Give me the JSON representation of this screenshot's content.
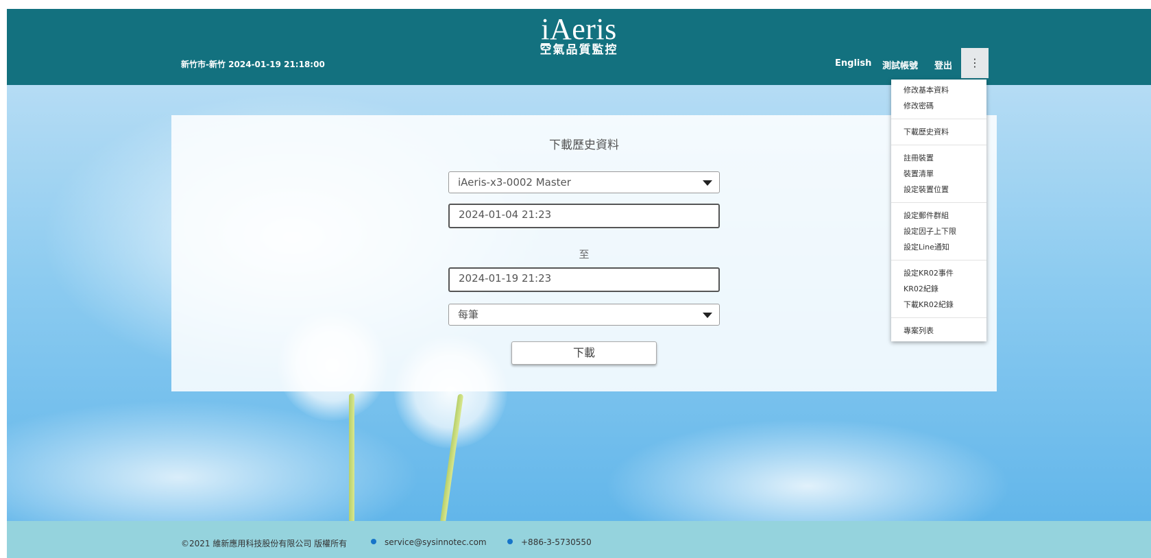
{
  "header": {
    "location_time": "新竹市-新竹 2024-01-19 21:18:00",
    "logo_text_prefix": "i",
    "logo_text_rest": "Aeris",
    "logo_subtitle": "空氣品質監控",
    "nav": {
      "language": "English",
      "account": "測試帳號",
      "logout": "登出",
      "more_icon": "⋮"
    }
  },
  "menu": {
    "groups": [
      [
        "修改基本資料",
        "修改密碼"
      ],
      [
        "下載歷史資料"
      ],
      [
        "註冊裝置",
        "裝置清單",
        "設定裝置位置"
      ],
      [
        "設定郵件群組",
        "設定因子上下限",
        "設定Line通知"
      ],
      [
        "設定KR02事件",
        "KR02紀錄",
        "下載KR02紀錄"
      ],
      [
        "專案列表"
      ]
    ]
  },
  "form": {
    "title": "下載歷史資料",
    "device_select": "iAeris-x3-0002 Master",
    "start_date": "2024-01-04 21:23",
    "to_label": "至",
    "end_date": "2024-01-19 21:23",
    "interval_select": "每筆",
    "download_button": "下載"
  },
  "footer": {
    "copyright": "©2021 維新應用科技股份有限公司 版權所有",
    "email": "service@sysinnotec.com",
    "phone": "+886-3-5730550"
  },
  "colors": {
    "header": "#13717f",
    "footer": "#95d3dd",
    "bullet": "#1674c9"
  }
}
